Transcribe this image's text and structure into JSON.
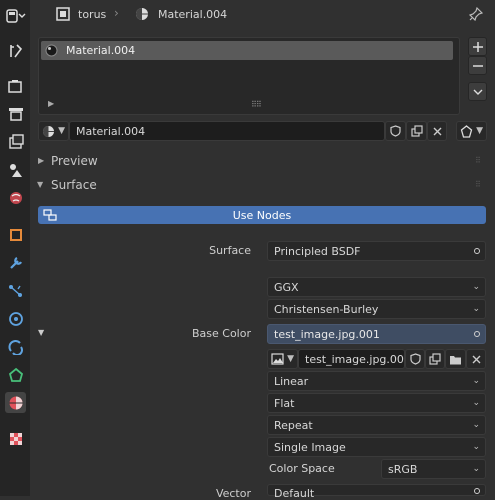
{
  "header": {
    "object_name": "torus",
    "material_name": "Material.004"
  },
  "material_slots": [
    {
      "name": "Material.004"
    }
  ],
  "datablock": {
    "name": "Material.004"
  },
  "panels": {
    "preview_label": "Preview",
    "surface_label": "Surface"
  },
  "use_nodes_label": "Use Nodes",
  "surface": {
    "label": "Surface",
    "shader": "Principled BSDF",
    "distribution": "GGX",
    "subsurface_method": "Christensen-Burley",
    "base_color": {
      "label": "Base Color",
      "value": "test_image.jpg.001"
    },
    "image": {
      "name": "test_image.jpg.001",
      "interpolation": "Linear",
      "projection": "Flat",
      "extension": "Repeat",
      "source": "Single Image",
      "color_space_label": "Color Space",
      "color_space": "sRGB"
    },
    "vector": {
      "label": "Vector",
      "value": "Default"
    }
  },
  "colors": {
    "accent_blue": "#4772b3",
    "active_field": "#3f4d63",
    "material_red": "#e0525b"
  }
}
